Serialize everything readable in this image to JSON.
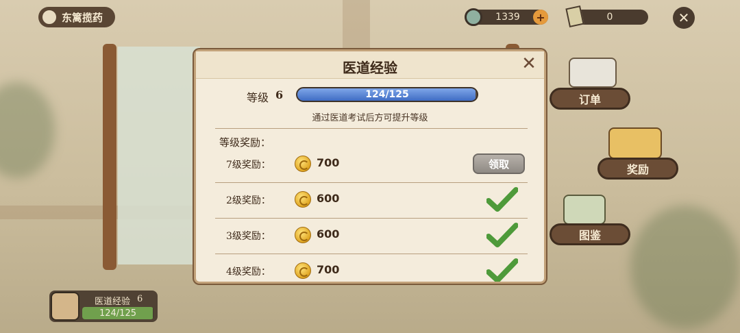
{
  "topbar": {
    "title": "东篱揽药",
    "currency_amount": "1339",
    "plus_label": "+",
    "ticket_amount": "0",
    "close_label": "✕"
  },
  "side_menu": {
    "orders_label": "订单",
    "rewards_label": "奖励",
    "catalog_label": "图鉴"
  },
  "exp_widget": {
    "title": "医道经验",
    "level": "6",
    "progress_text": "124/125",
    "progress_fraction": 0.992
  },
  "dialog": {
    "title": "医道经验",
    "close_label": "✕",
    "level_label": "等级",
    "level_value": "6",
    "progress_text": "124/125",
    "progress_fraction": 0.992,
    "hint": "通过医道考试后方可提升等级",
    "section_title": "等级奖励：",
    "rewards": [
      {
        "label": "7级奖励：",
        "amount": "700",
        "state": "claim",
        "button_label": "领取"
      },
      {
        "label": "2级奖励：",
        "amount": "600",
        "state": "claimed"
      },
      {
        "label": "3级奖励：",
        "amount": "600",
        "state": "claimed"
      },
      {
        "label": "4级奖励：",
        "amount": "700",
        "state": "claimed"
      }
    ]
  },
  "colors": {
    "progress_blue": "#3f6cc4",
    "progress_green": "#6da04a",
    "check_green": "#4e9a3a",
    "panel_bg": "#f4ecdc"
  },
  "icons": {
    "coin": "gold-coin-icon",
    "check": "checkmark-icon"
  }
}
